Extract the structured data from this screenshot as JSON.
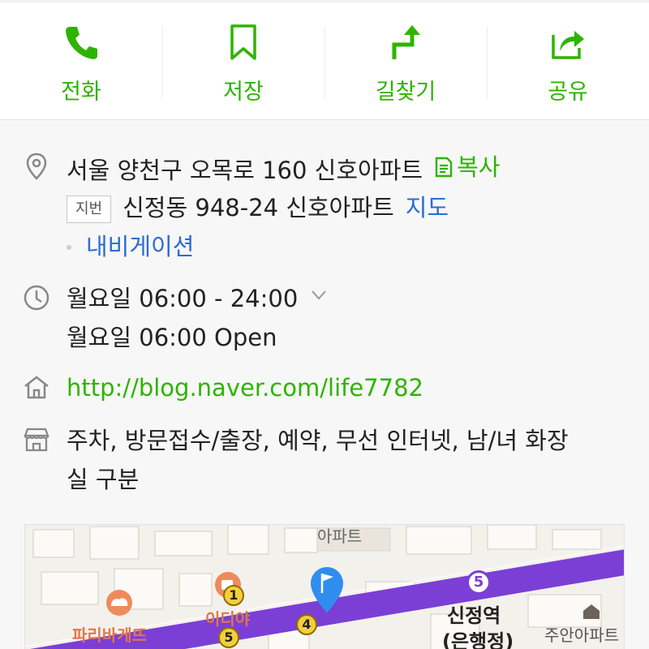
{
  "actions": [
    {
      "label": "전화",
      "icon": "phone-icon"
    },
    {
      "label": "저장",
      "icon": "bookmark-icon"
    },
    {
      "label": "길찾기",
      "icon": "directions-icon"
    },
    {
      "label": "공유",
      "icon": "share-icon"
    }
  ],
  "address": {
    "road": "서울 양천구 오목로 160 신호아파트",
    "copy_label": "복사",
    "jibun_badge": "지번",
    "jibun": "신정동 948-24 신호아파트",
    "map_link": "지도",
    "navigation": "내비게이션"
  },
  "hours": {
    "today": "월요일 06:00 - 24:00",
    "open_note": "월요일 06:00 Open"
  },
  "homepage": {
    "url": "http://blog.naver.com/life7782"
  },
  "amenities": {
    "line1": "주차, 방문접수/출장, 예약, 무선 인터넷, 남/녀 화장",
    "line2": "실 구분"
  },
  "map": {
    "labels": {
      "apartment_top": "아파트",
      "paris": "파리바게뜨",
      "ediya": "이디야",
      "station": "신정역",
      "station_sub": "(은행정)",
      "juan": "주안아파트"
    },
    "badges": {
      "subway_line5": "5",
      "marker_1": "1",
      "marker_5": "5",
      "marker_4": "4"
    },
    "colors": {
      "subway_line": "#7b3fd6",
      "pin": "#2f8df0",
      "accent_green": "#2db400",
      "link_blue": "#2b6bd6"
    }
  }
}
